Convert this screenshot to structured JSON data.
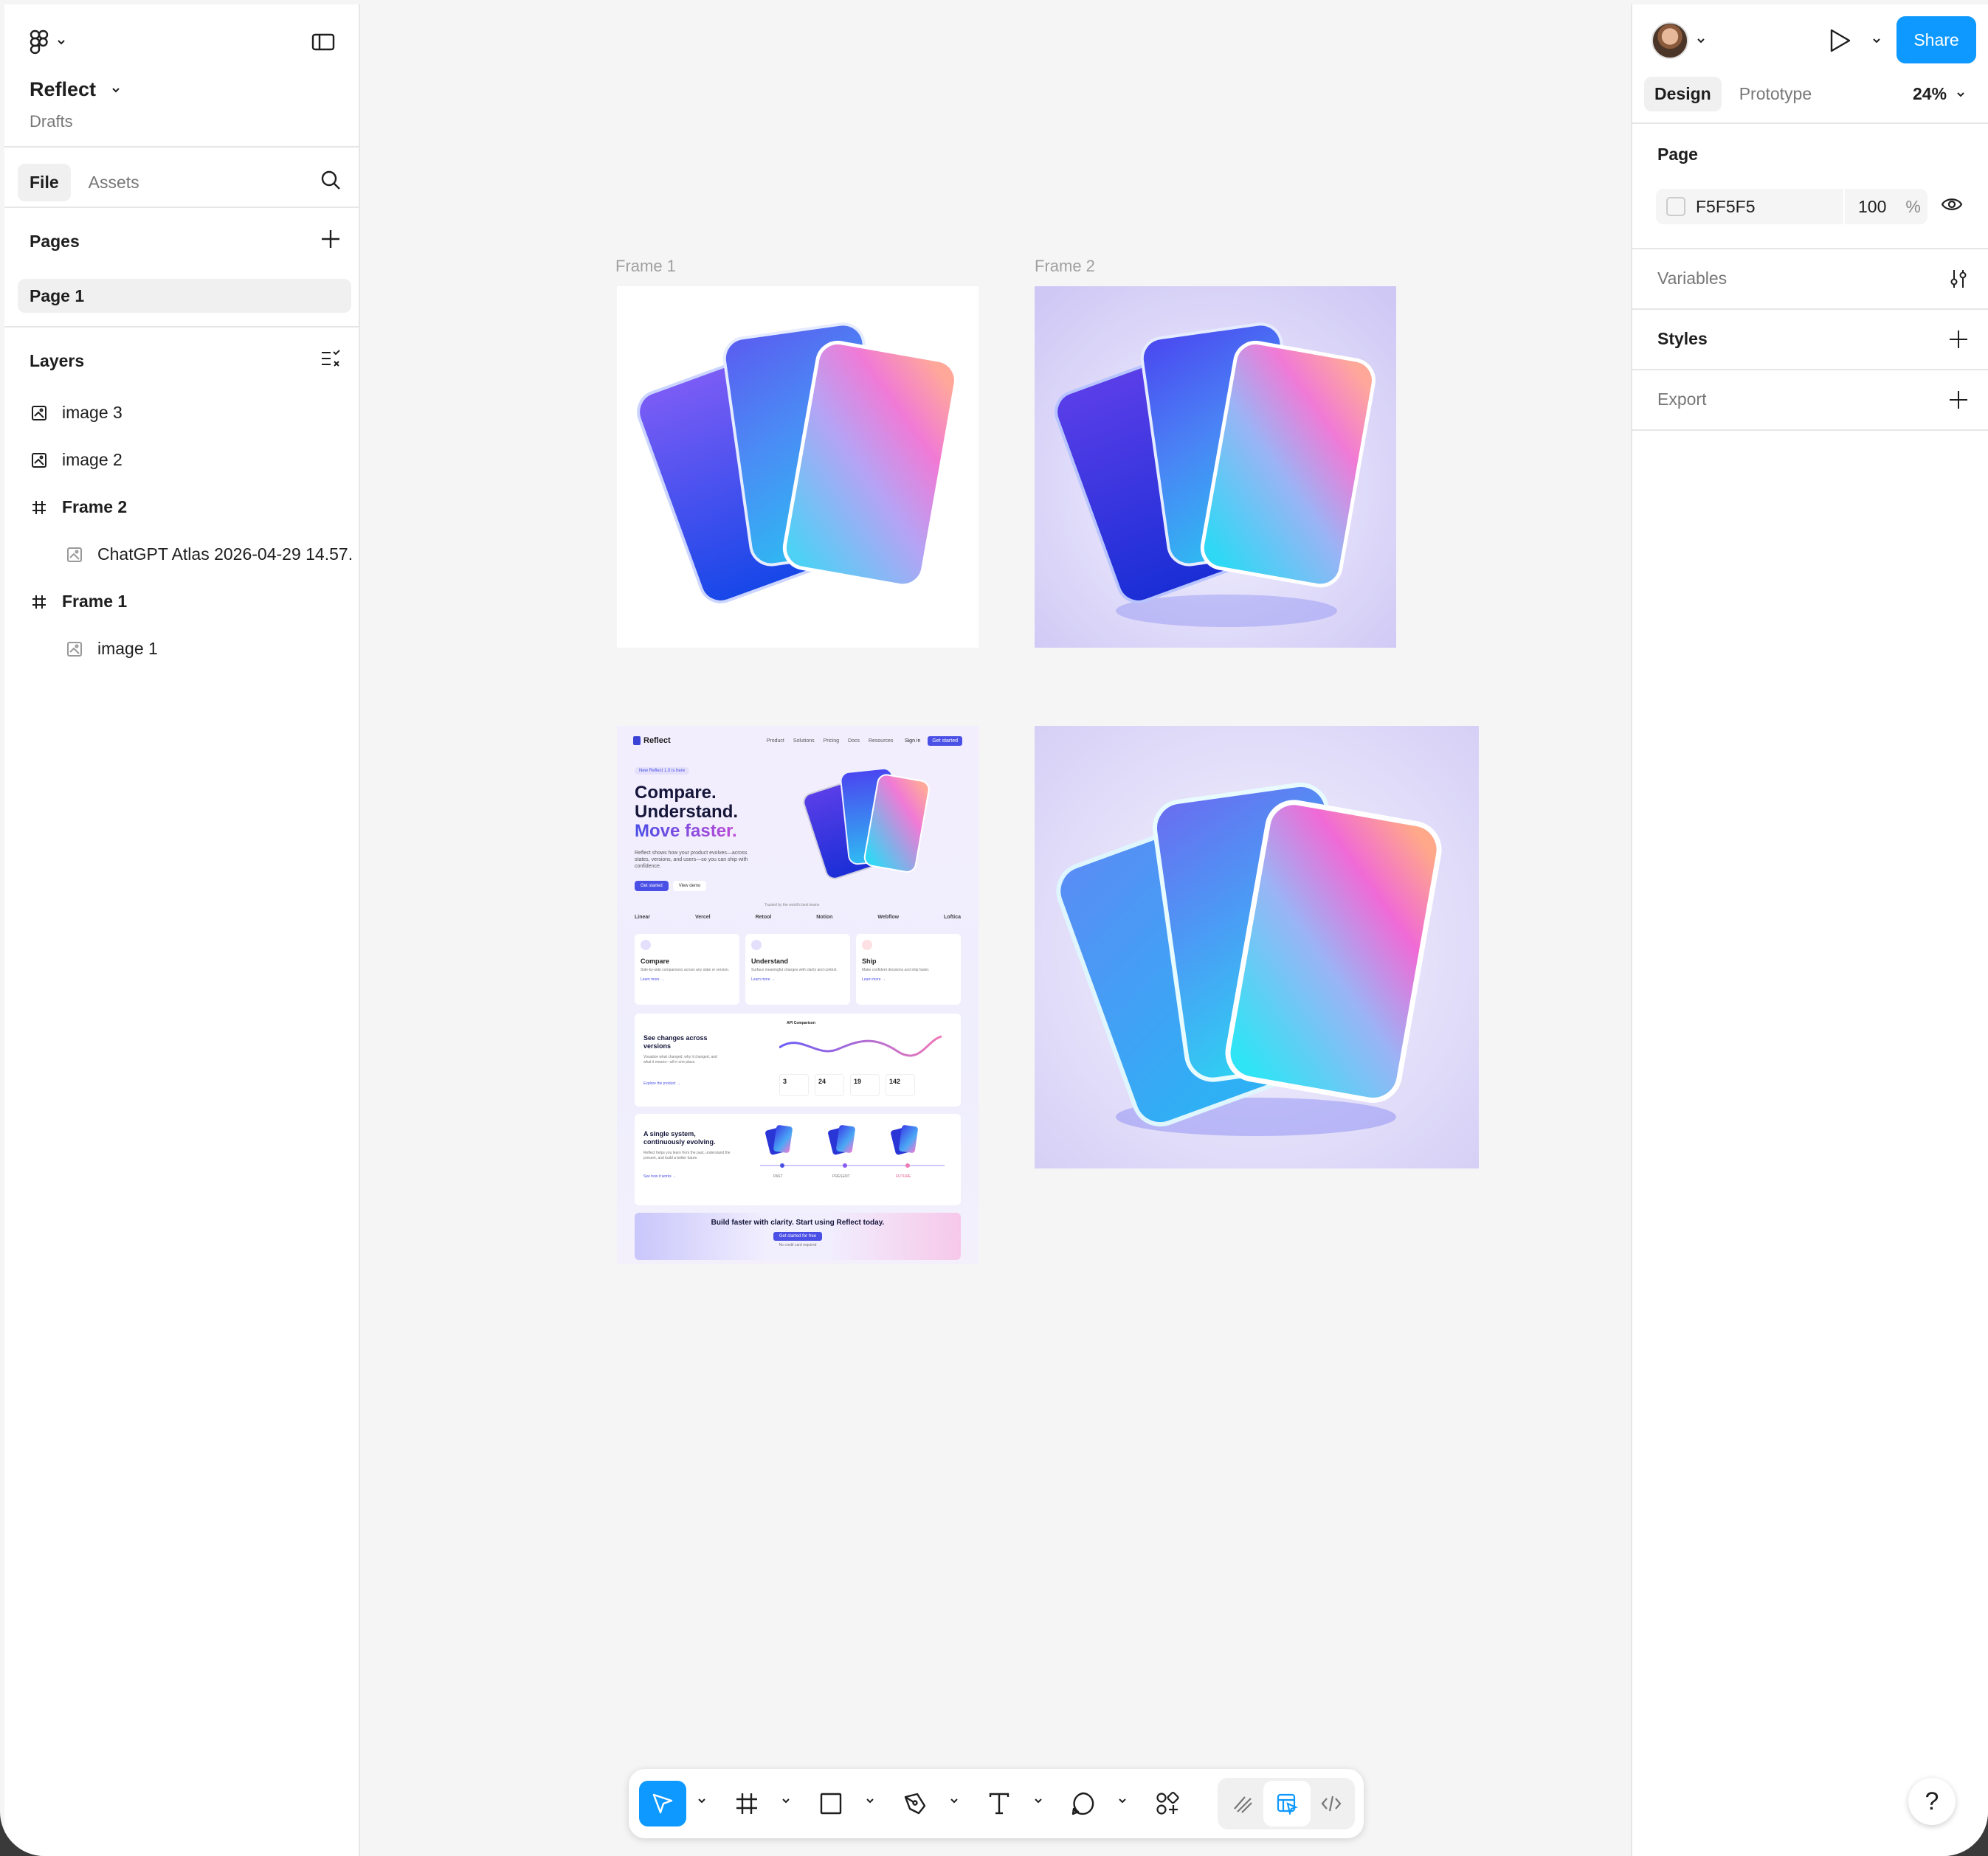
{
  "file": {
    "name": "Reflect",
    "location": "Drafts"
  },
  "left_tabs": [
    "File",
    "Assets"
  ],
  "pages": {
    "title": "Pages",
    "items": [
      "Page 1"
    ]
  },
  "layers": {
    "title": "Layers",
    "items": [
      {
        "name": "image 3",
        "type": "image",
        "indent": 0
      },
      {
        "name": "image 2",
        "type": "image",
        "indent": 0
      },
      {
        "name": "Frame 2",
        "type": "frame",
        "indent": 0
      },
      {
        "name": "ChatGPT Atlas 2026-04-29 14.57.",
        "type": "image",
        "indent": 1
      },
      {
        "name": "Frame 1",
        "type": "frame",
        "indent": 0
      },
      {
        "name": "image 1",
        "type": "image",
        "indent": 1
      }
    ]
  },
  "right": {
    "share_label": "Share",
    "tabs": [
      "Design",
      "Prototype"
    ],
    "zoom": "24%",
    "page_section": "Page",
    "page_color": "F5F5F5",
    "page_opacity": "100",
    "opacity_unit": "%",
    "variables": "Variables",
    "styles": "Styles",
    "export": "Export",
    "help": "?"
  },
  "canvas": {
    "frame1_label": "Frame 1",
    "frame2_label": "Frame 2",
    "background": "#F5F5F5"
  },
  "site": {
    "brand": "Reflect",
    "nav": [
      "Product",
      "Solutions",
      "Pricing",
      "Docs",
      "Resources"
    ],
    "sign_in": "Sign in",
    "get_started": "Get started",
    "badge": "New  Reflect 1.0 is here",
    "hero_line1": "Compare.",
    "hero_line2": "Understand.",
    "hero_line3": "Move faster.",
    "hero_desc": "Reflect shows how your product evolves—across states, versions, and users—so you can ship with confidence.",
    "btn_primary": "Get started",
    "btn_secondary": "View demo",
    "trusted": "Trusted by the world's best teams",
    "logos": [
      "Linear",
      "Vercel",
      "Retool",
      "Notion",
      "Webflow",
      "Loftica"
    ],
    "features": [
      {
        "title": "Compare",
        "desc": "Side-by-side comparisons across any state or version.",
        "link": "Learn more →"
      },
      {
        "title": "Understand",
        "desc": "Surface meaningful changes with clarity and context.",
        "link": "Learn more →"
      },
      {
        "title": "Ship",
        "desc": "Make confident decisions and ship faster.",
        "link": "Learn more →"
      }
    ],
    "panel1_title": "See changes across versions",
    "panel1_desc": "Visualize what changed, why it changed, and what it means—all in one place.",
    "panel1_link": "Explore the product →",
    "panel1_chart": "API Comparison",
    "stats": [
      "3",
      "24",
      "19",
      "142"
    ],
    "panel2_title": "A single system, continuously evolving.",
    "panel2_desc": "Reflect helps you learn from the past, understand the present, and build a better future.",
    "panel2_link": "See how it works →",
    "timeline": [
      "PAST",
      "PRESENT",
      "FUTURE"
    ],
    "cta_title": "Build faster with clarity. Start using Reflect today.",
    "cta_button": "Get started for free",
    "cta_note": "No credit card required"
  },
  "colors": {
    "accent": "#0D99FF",
    "selected_bg": "#F0F0F0"
  },
  "icons": [
    "figma-logo-icon",
    "sidebar-toggle-icon",
    "search-icon",
    "plus-icon",
    "layers-list-icon",
    "image-icon",
    "frame-hash-icon",
    "play-icon",
    "eye-icon",
    "variables-sliders-icon",
    "move-cursor-icon",
    "frame-tool-icon",
    "rectangle-tool-icon",
    "pen-tool-icon",
    "text-tool-icon",
    "comment-tool-icon",
    "actions-icon",
    "draw-icon",
    "design-mode-icon",
    "dev-mode-icon"
  ]
}
